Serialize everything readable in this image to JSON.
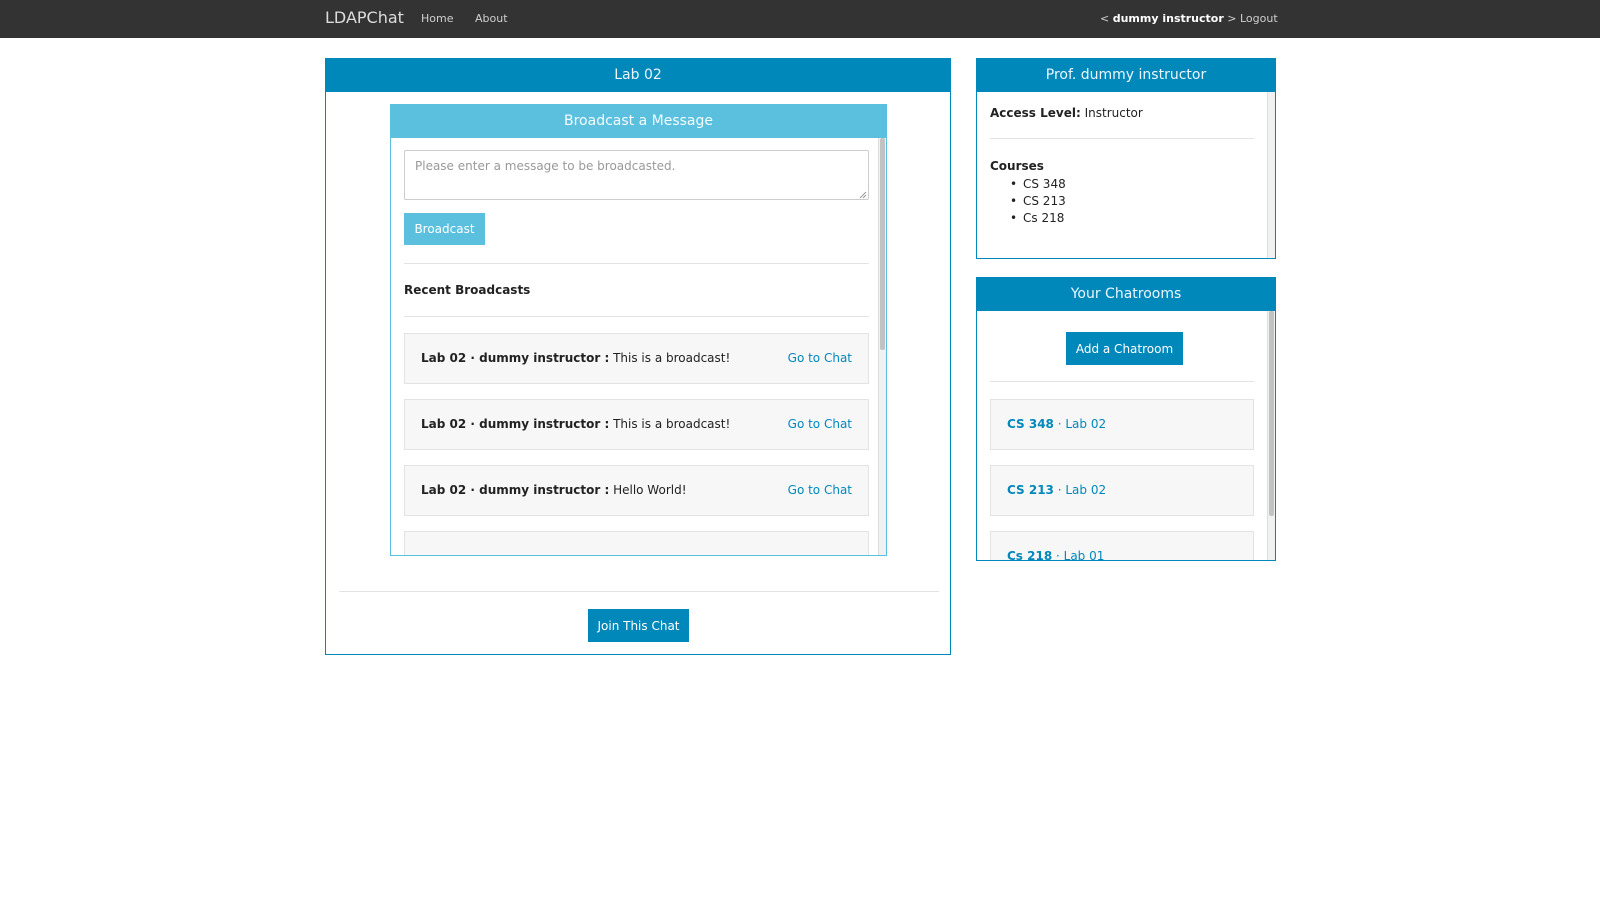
{
  "navbar": {
    "brand": "LDAPChat",
    "home": "Home",
    "about": "About",
    "user_open": "< ",
    "user_name": "dummy instructor",
    "user_close": " >",
    "logout": "Logout"
  },
  "main": {
    "title": "Lab 02",
    "broadcast": {
      "title": "Broadcast a Message",
      "placeholder": "Please enter a message to be broadcasted.",
      "button": "Broadcast",
      "recent_title": "Recent Broadcasts",
      "items": [
        {
          "prefix": "Lab 02 · dummy instructor :",
          "message": "This is a broadcast!",
          "link": "Go to Chat"
        },
        {
          "prefix": "Lab 02 · dummy instructor :",
          "message": "This is a broadcast!",
          "link": "Go to Chat"
        },
        {
          "prefix": "Lab 02 · dummy instructor :",
          "message": "Hello World!",
          "link": "Go to Chat"
        }
      ]
    },
    "join_button": "Join This Chat"
  },
  "profile": {
    "title": "Prof. dummy instructor",
    "access_label": "Access Level:",
    "access_value": "Instructor",
    "courses_title": "Courses",
    "courses": [
      "CS 348",
      "CS 213",
      "Cs 218"
    ]
  },
  "chatrooms": {
    "title": "Your Chatrooms",
    "add_button": "Add a Chatroom",
    "items": [
      {
        "course": "CS 348",
        "sep": " · ",
        "room": "Lab 02"
      },
      {
        "course": "CS 213",
        "sep": " · ",
        "room": "Lab 02"
      },
      {
        "course": "Cs 218",
        "sep": " · ",
        "room": "Lab 01"
      }
    ]
  },
  "colors": {
    "primary": "#0088bb",
    "info": "#5bc0de",
    "navbar": "#333333"
  }
}
